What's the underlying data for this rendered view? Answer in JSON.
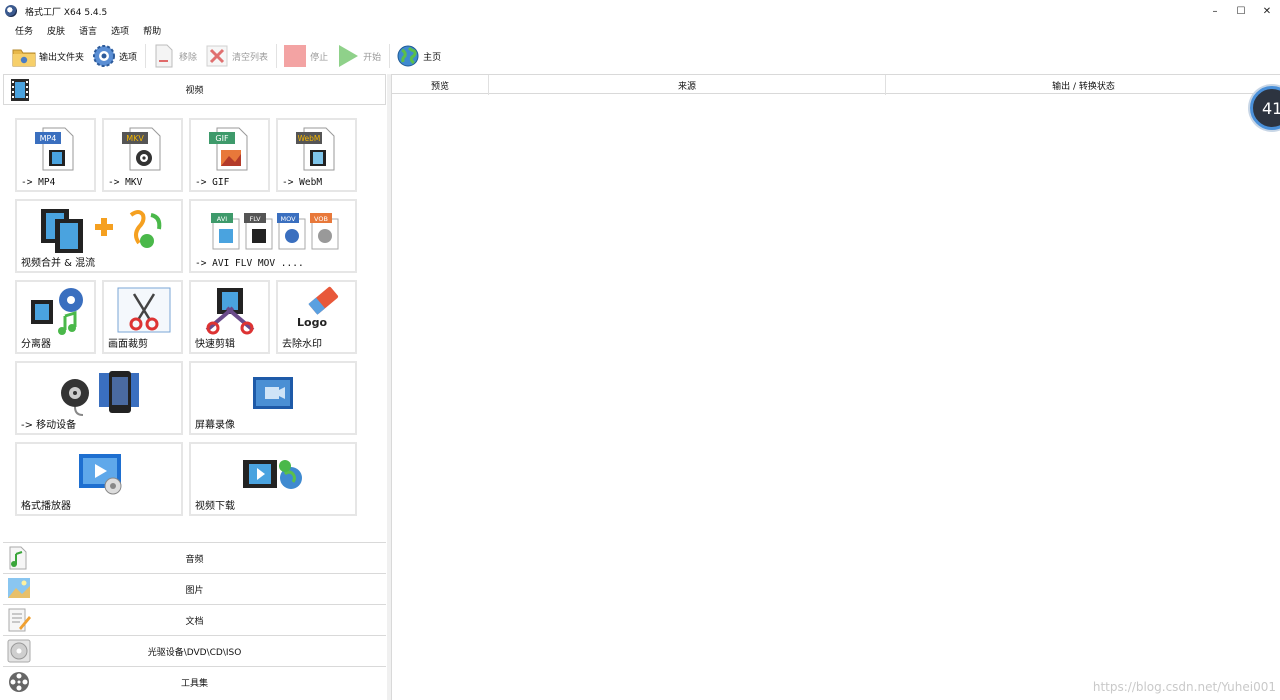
{
  "titlebar": {
    "title": "格式工厂 X64 5.4.5",
    "minimize": "–",
    "maximize": "☐",
    "close": "✕"
  },
  "menu": [
    "任务",
    "皮肤",
    "语言",
    "选项",
    "帮助"
  ],
  "toolbar": {
    "output_folder": "输出文件夹",
    "options": "选项",
    "remove": "移除",
    "clear_list": "清空列表",
    "stop": "停止",
    "start": "开始",
    "home": "主页"
  },
  "left": {
    "video_header": "视频",
    "tiles": {
      "mp4": {
        "label": "-> MP4",
        "badge": "MP4"
      },
      "mkv": {
        "label": "-> MKV",
        "badge": "MKV"
      },
      "gif": {
        "label": "-> GIF",
        "badge": "GIF"
      },
      "webm": {
        "label": "-> WebM",
        "badge": "WebM"
      },
      "merge": {
        "label": "视频合并 & 混流"
      },
      "avi": {
        "label": "-> AVI FLV MOV ....",
        "badges": [
          "AVI",
          "FLV",
          "MOV",
          "VOB"
        ]
      },
      "splitter": {
        "label": "分离器"
      },
      "crop": {
        "label": "画面裁剪"
      },
      "quick_edit": {
        "label": "快速剪辑"
      },
      "remove_watermark": {
        "label": "去除水印",
        "logo_text": "Logo"
      },
      "mobile": {
        "label": "-> 移动设备"
      },
      "screen_record": {
        "label": "屏幕录像"
      },
      "player": {
        "label": "格式播放器"
      },
      "download": {
        "label": "视频下载"
      }
    },
    "bottom_categories": [
      "音频",
      "图片",
      "文档",
      "光驱设备\\DVD\\CD\\ISO",
      "工具集"
    ]
  },
  "grid": {
    "columns": [
      "预览",
      "来源",
      "输出 / 转换状态"
    ]
  },
  "badge_text": "41",
  "watermark": "https://blog.csdn.net/Yuhei001",
  "colors": {
    "accent_blue": "#3a78c9",
    "border": "#d9d9d9",
    "tile_border": "#e6e6e6",
    "disabled_text": "#9a9a9a",
    "stop_red": "#f0a0a0",
    "start_green": "#8fd18a"
  }
}
